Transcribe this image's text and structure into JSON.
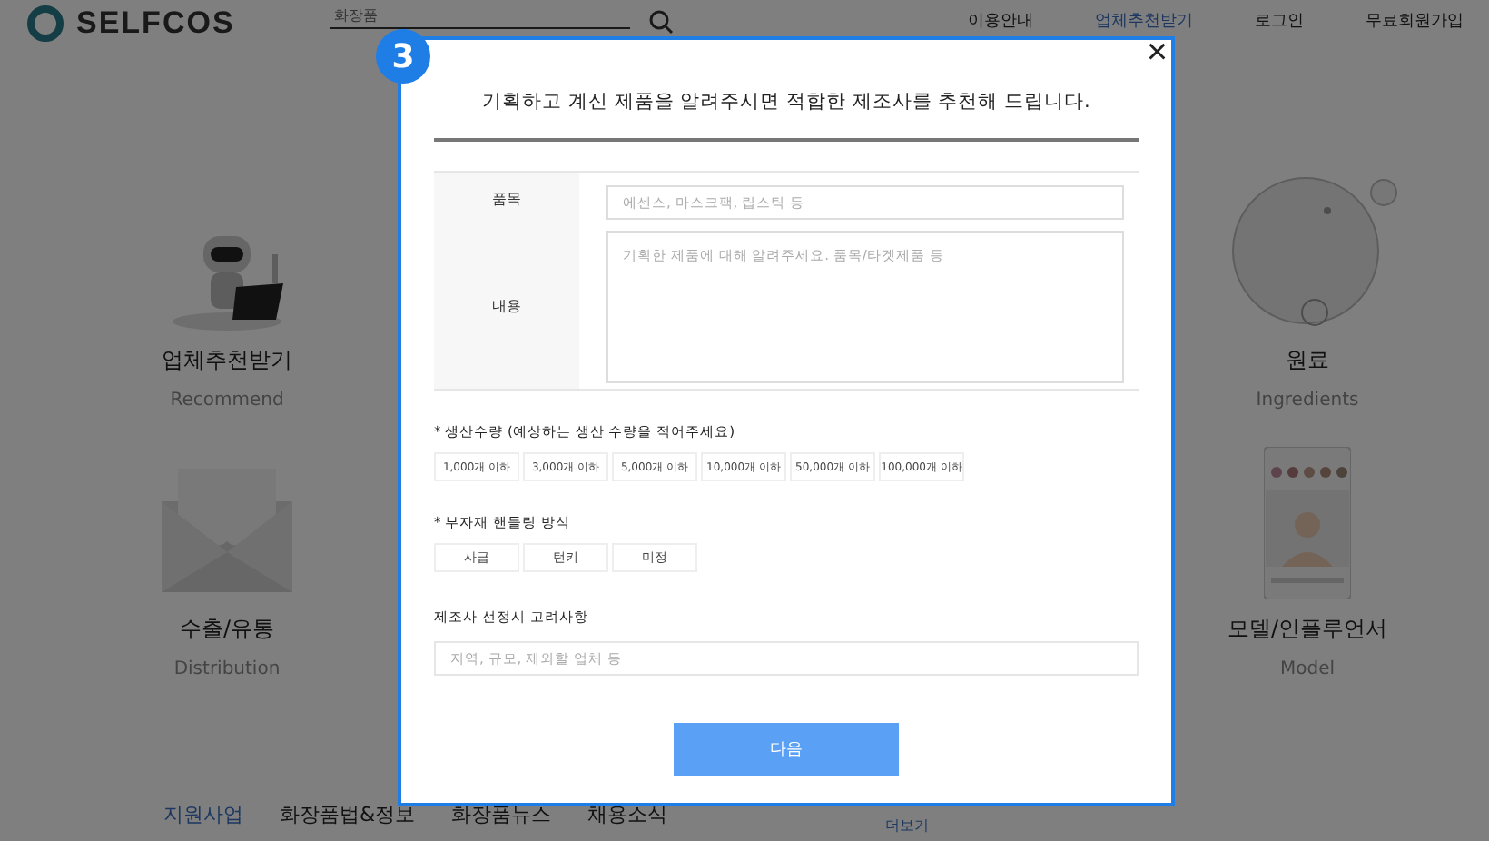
{
  "header": {
    "logo": "SELFCOS",
    "search": {
      "value": "화장품"
    },
    "nav": [
      {
        "label": "이용안내",
        "selected": false
      },
      {
        "label": "업체추천받기",
        "selected": true
      },
      {
        "label": "로그인",
        "selected": false
      },
      {
        "label": "무료회원가입",
        "selected": false
      }
    ]
  },
  "services": [
    {
      "title": "업체추천받기",
      "subtitle": "Recommend"
    },
    {
      "title": "원료",
      "subtitle": "Ingredients"
    },
    {
      "title": "수출/유통",
      "subtitle": "Distribution"
    },
    {
      "title": "모델/인플루언서",
      "subtitle": "Model"
    }
  ],
  "board_tabs": [
    {
      "label": "지원사업",
      "selected": true
    },
    {
      "label": "화장품법&정보",
      "selected": false
    },
    {
      "label": "화장품뉴스",
      "selected": false
    },
    {
      "label": "채용소식",
      "selected": false
    }
  ],
  "more_link": "더보기",
  "modal": {
    "step": "3",
    "close": "×",
    "title": "기획하고 계신 제품을 알려주시면 적합한 제조사를 추천해 드립니다.",
    "fields": [
      {
        "label": "품목",
        "kind": "input",
        "placeholder": "에센스, 마스크팩, 립스틱 등"
      },
      {
        "label": "내용",
        "kind": "textarea",
        "placeholder": "기획한 제품에 대해 알려주세요. 품목/타겟제품 등"
      }
    ],
    "quantity": {
      "label": "* 생산수량 (예상하는 생산 수량을 적어주세요)",
      "options": [
        {
          "label": "1,000개 이하",
          "selected": false
        },
        {
          "label": "3,000개 이하",
          "selected": false
        },
        {
          "label": "5,000개 이하",
          "selected": false
        },
        {
          "label": "10,000개 이하",
          "selected": false
        },
        {
          "label": "50,000개 이하",
          "selected": false
        },
        {
          "label": "100,000개 이하",
          "selected": false
        }
      ]
    },
    "handling": {
      "label": "* 부자재 핸들링 방식",
      "options": [
        {
          "label": "사급",
          "selected": false
        },
        {
          "label": "턴키",
          "selected": false
        },
        {
          "label": "미정",
          "selected": false
        }
      ]
    },
    "considerations": {
      "label": "제조사 선정시 고려사항",
      "placeholder": "지역, 규모, 제외할 업체 등"
    },
    "next_button": "다음"
  }
}
